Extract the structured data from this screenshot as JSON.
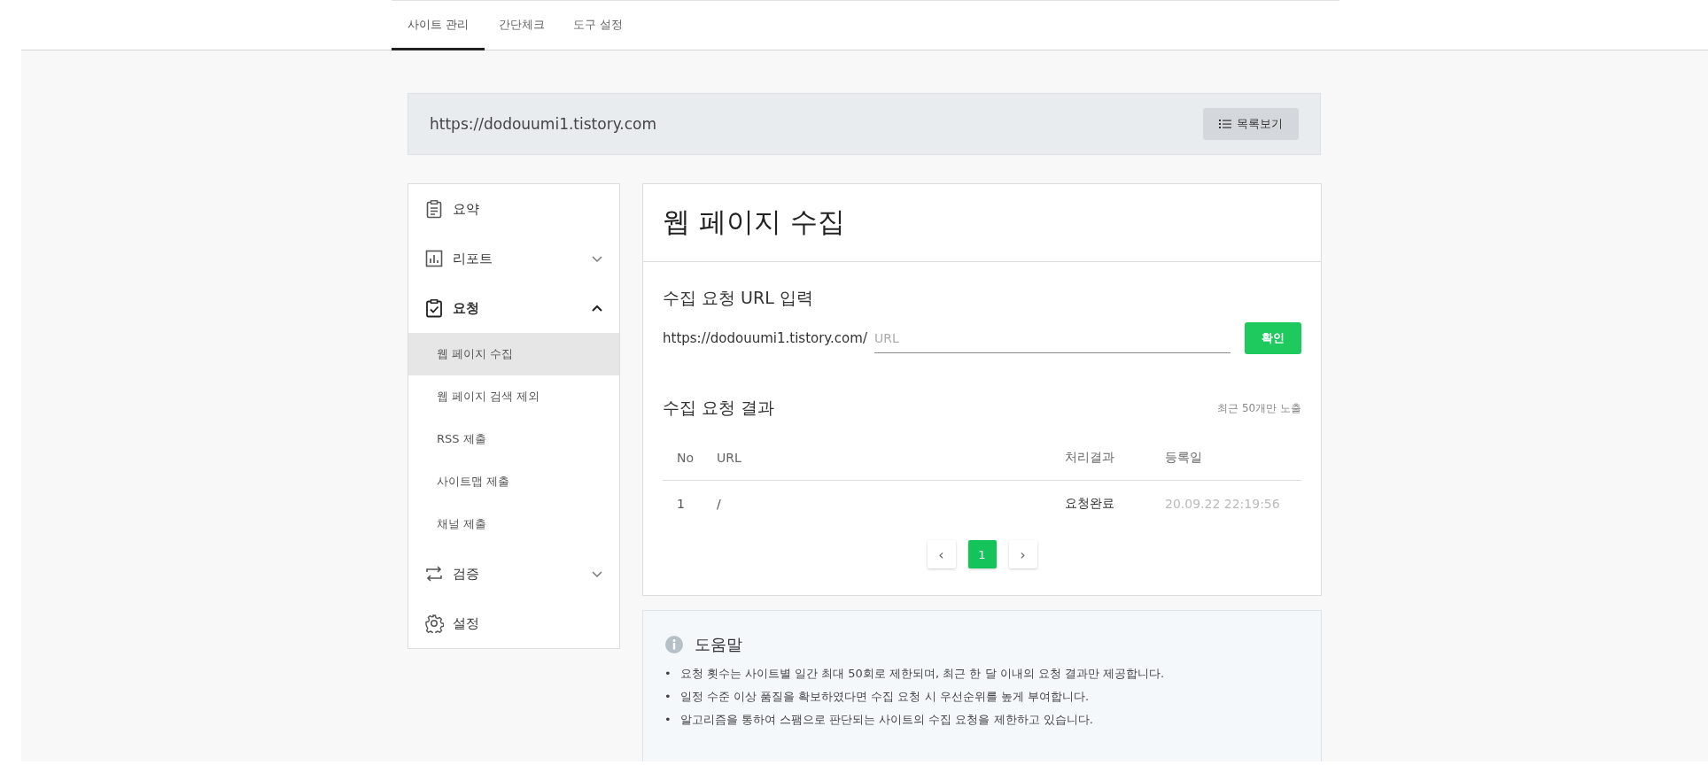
{
  "tabs": [
    {
      "label": "사이트 관리",
      "selected": true
    },
    {
      "label": "간단체크",
      "selected": false
    },
    {
      "label": "도구 설정",
      "selected": false
    }
  ],
  "site_bar": {
    "url": "https://dodouumi1.tistory.com",
    "button": "목록보기"
  },
  "sidebar": {
    "items": [
      {
        "label": "요약"
      },
      {
        "label": "리포트",
        "expanded": false
      },
      {
        "label": "요청",
        "expanded": true,
        "children": [
          {
            "label": "웹 페이지 수집",
            "selected": true
          },
          {
            "label": "웹 페이지 검색 제외",
            "selected": false
          },
          {
            "label": "RSS 제출",
            "selected": false
          },
          {
            "label": "사이트맵 제출",
            "selected": false
          },
          {
            "label": "채널 제출",
            "selected": false
          }
        ]
      },
      {
        "label": "검증",
        "expanded": false
      },
      {
        "label": "설정"
      }
    ]
  },
  "main": {
    "title": "웹 페이지 수집",
    "input_section": {
      "heading": "수집 요청 URL 입력",
      "prefix": "https://dodouumi1.tistory.com/",
      "placeholder": "URL",
      "button": "확인"
    },
    "results": {
      "heading": "수집 요청 결과",
      "note": "최근 50개만 노출",
      "columns": [
        "No",
        "URL",
        "처리결과",
        "등록일"
      ],
      "rows": [
        [
          "1",
          "/",
          "요청완료",
          "20.09.22 22:19:56"
        ]
      ],
      "pagination": {
        "prev": "‹",
        "pages": [
          {
            "label": "1",
            "selected": true
          }
        ],
        "next": "›"
      }
    }
  },
  "help": {
    "heading": "도움말",
    "items": [
      {
        "bullet": "•",
        "text": "요청 횟수는 사이트별 일간 최대 50회로 제한되며, 최근 한 달 이내의 요청 결과만 제공합니다."
      },
      {
        "bullet": "•",
        "text": "일정 수준 이상 품질을 확보하였다면 수집 요청 시 우선순위를 높게 부여합니다."
      },
      {
        "bullet": "•",
        "text": "알고리즘을 통하여 스팸으로 판단되는 사이트의 수집 요청을 제한하고 있습니다."
      }
    ]
  }
}
